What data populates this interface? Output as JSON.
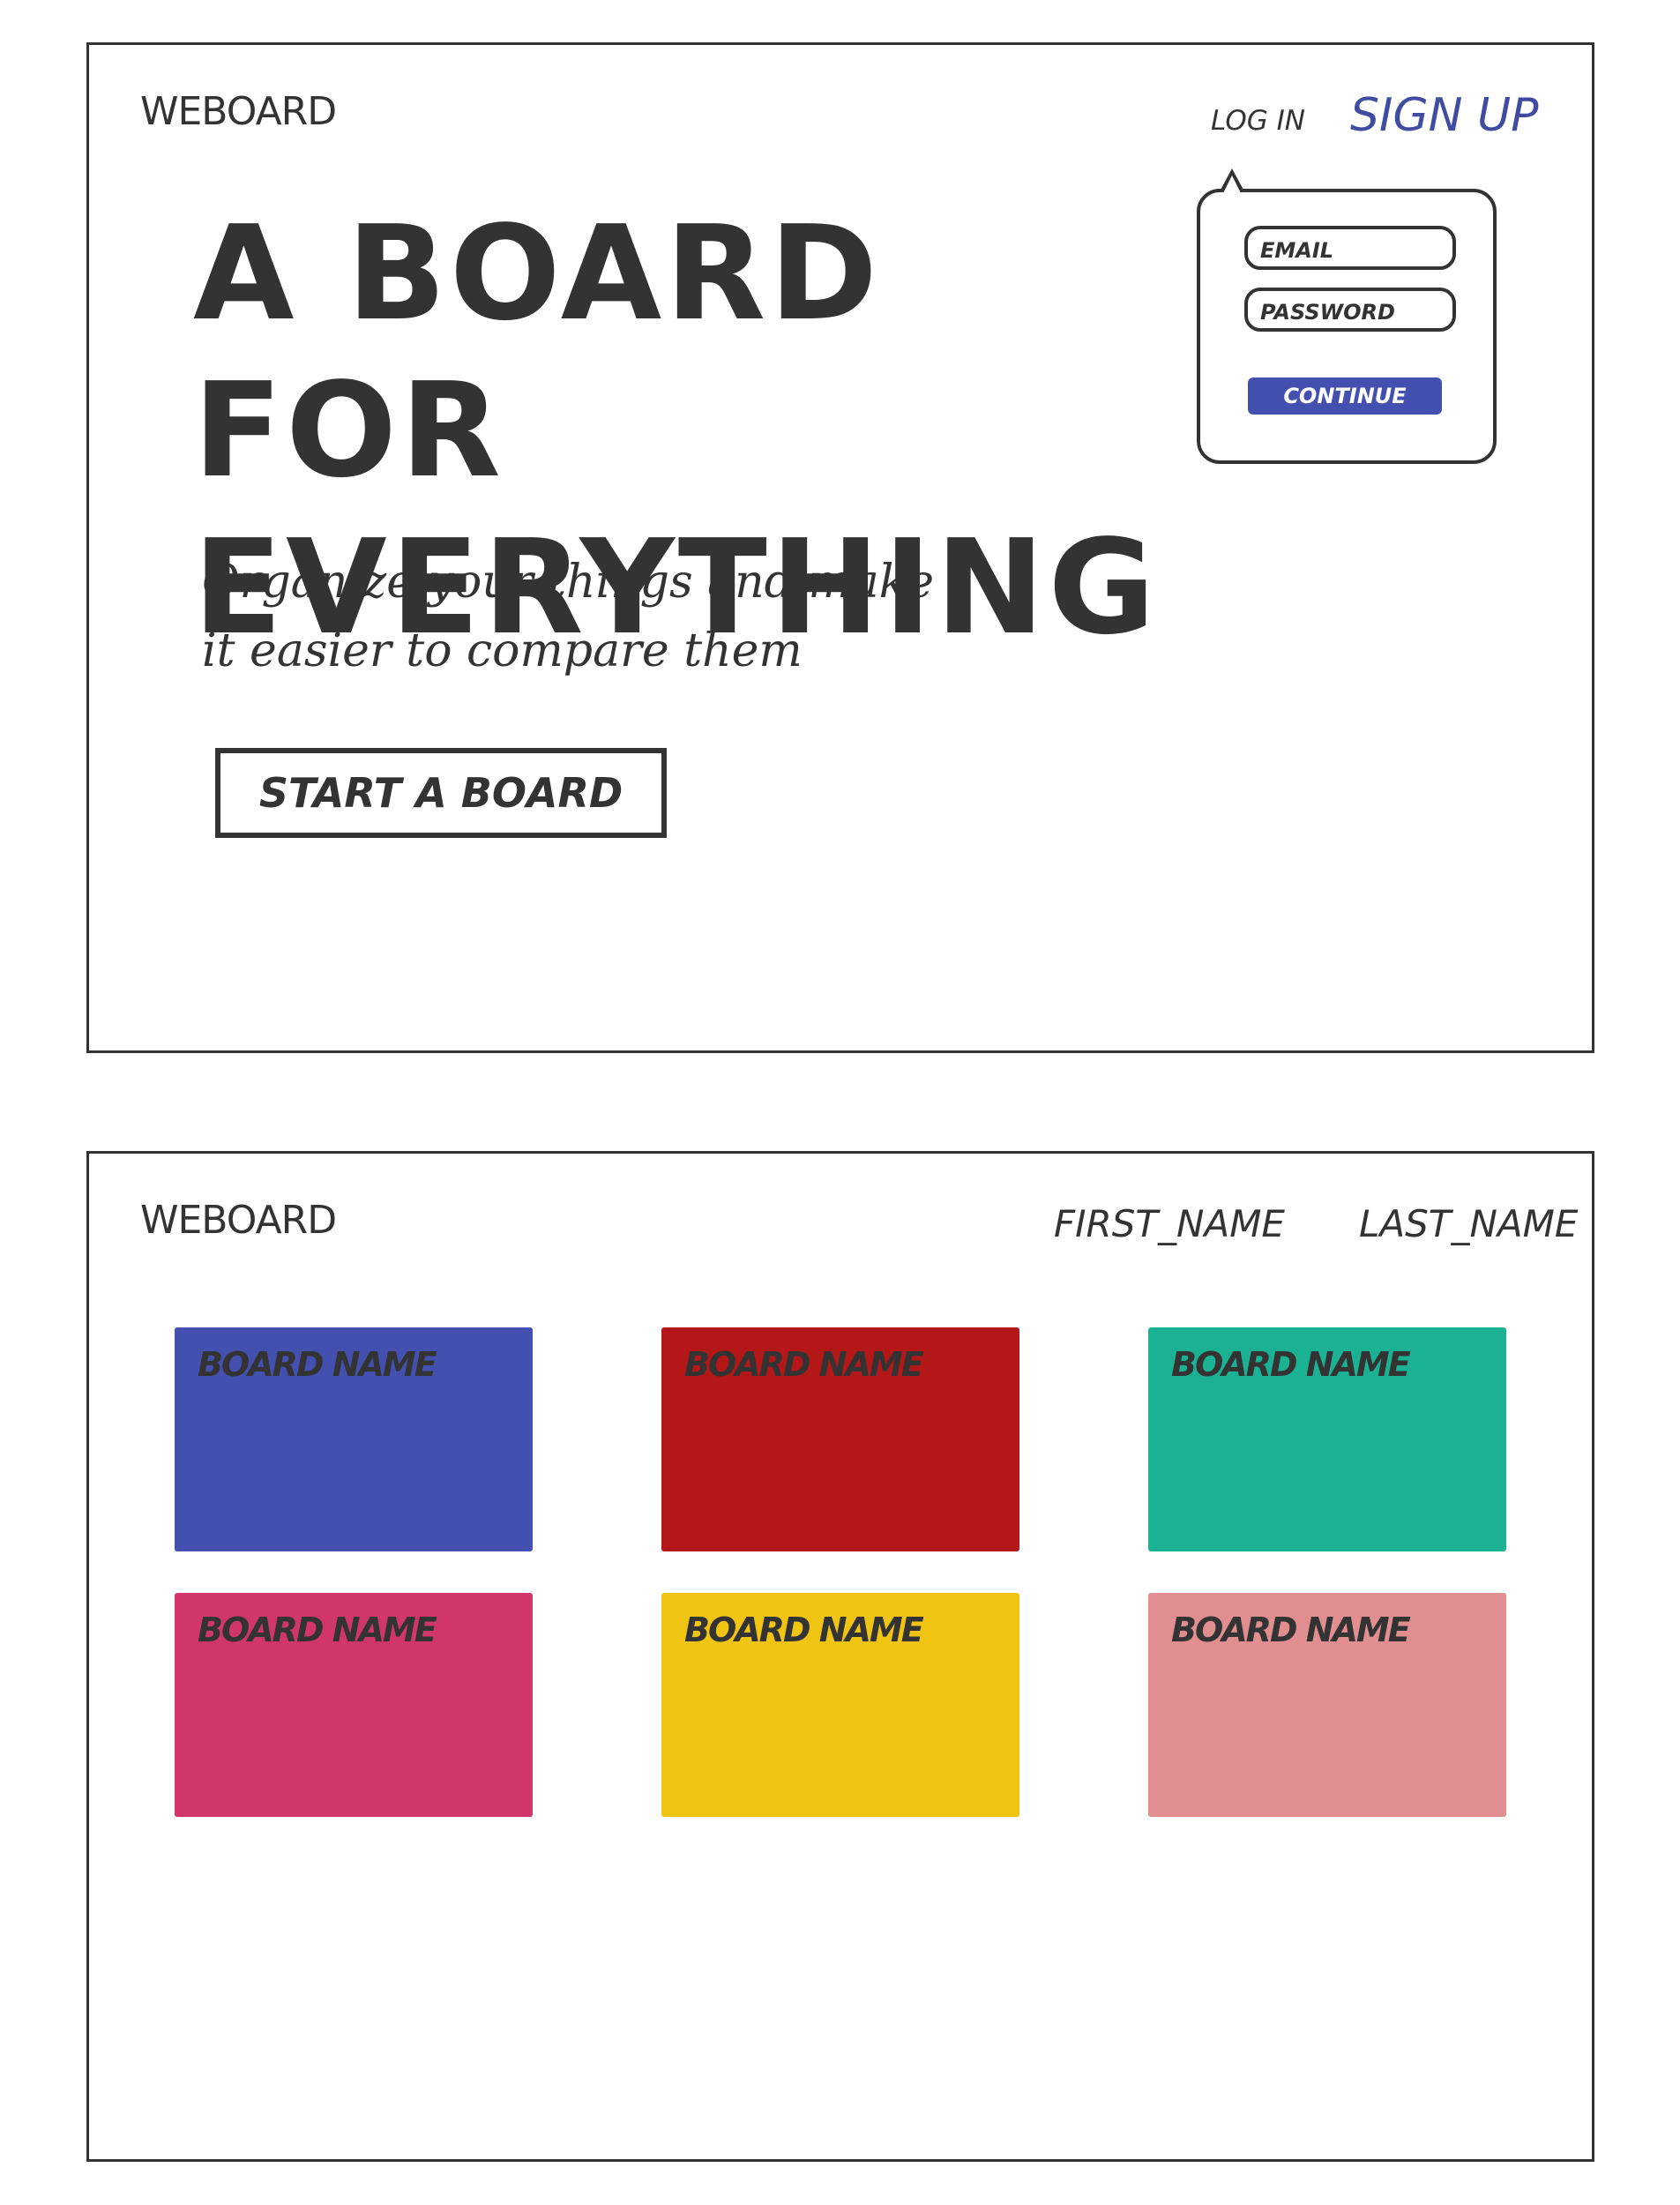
{
  "landing": {
    "logo": "WEBOARD",
    "nav": {
      "login": "LOG IN",
      "signup": "SIGN UP"
    },
    "hero": {
      "title_line1": "A BOARD FOR",
      "title_line2": "EVERYTHING",
      "subtitle_line1": "Organize your things and make",
      "subtitle_line2": "it easier to compare them",
      "cta": "START A BOARD"
    },
    "signup_form": {
      "email_placeholder": "EMAIL",
      "password_placeholder": "PASSWORD",
      "continue": "CONTINUE"
    }
  },
  "dashboard": {
    "logo": "WEBOARD",
    "user": {
      "first_name": "FIRST_NAME",
      "last_name": "LAST_NAME"
    },
    "boards": [
      {
        "name": "BOARD NAME",
        "color": "#4350b0"
      },
      {
        "name": "BOARD NAME",
        "color": "#b31717"
      },
      {
        "name": "BOARD NAME",
        "color": "#1bb294"
      },
      {
        "name": "BOARD NAME",
        "color": "#d13668"
      },
      {
        "name": "BOARD NAME",
        "color": "#f0c413"
      },
      {
        "name": "BOARD NAME",
        "color": "#e08e8f"
      }
    ]
  },
  "colors": {
    "ink": "#333333",
    "accent": "#3f4ca0",
    "button": "#4350b0"
  }
}
